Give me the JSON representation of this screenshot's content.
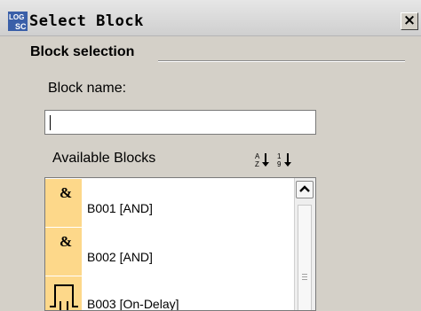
{
  "window": {
    "title": "Select Block",
    "close_label": "×",
    "icon_name": "logo-soft-comfort-icon"
  },
  "group": {
    "label": "Block selection"
  },
  "block_name": {
    "label": "Block name:",
    "value": "",
    "placeholder": ""
  },
  "available": {
    "label": "Available Blocks",
    "sort_alpha_icon": "sort-az-icon",
    "sort_numeric_icon": "sort-19-icon"
  },
  "blocks": [
    {
      "tile_symbol": "&",
      "label": "B001 [AND]",
      "icon": "and-gate-icon",
      "tile_color": "#fdd88a"
    },
    {
      "tile_symbol": "&",
      "label": "B002 [AND]",
      "icon": "and-gate-icon",
      "tile_color": "#fdd88a"
    },
    {
      "tile_symbol": "",
      "label": "B003 [On-Delay]",
      "icon": "on-delay-pulse-icon",
      "tile_color": "#fdd88a"
    }
  ],
  "colors": {
    "window_bg": "#d4d0c8",
    "tile_bg": "#fdd88a",
    "list_bg": "#ffffff"
  }
}
